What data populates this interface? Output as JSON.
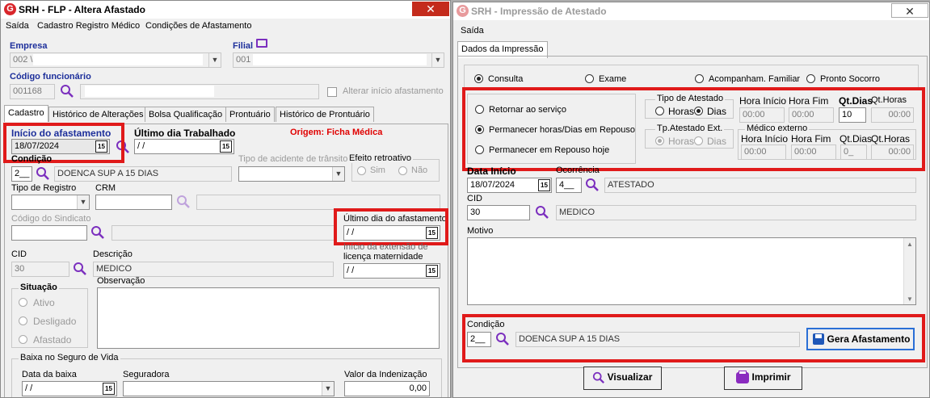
{
  "left": {
    "title": "SRH - FLP - Altera Afastado",
    "menu": [
      "Saída",
      "Cadastro Registro Médico",
      "Condições de Afastamento"
    ],
    "empresa_label": "Empresa",
    "empresa_value": "002 \\",
    "filial_label": "Filial",
    "filial_value": "001",
    "codigo_label": "Código funcionário",
    "codigo_value": "001168",
    "alterar_label": "Alterar início afastamento",
    "tabs": [
      "Cadastro",
      "Histórico de Alterações",
      "Bolsa Qualificação",
      "Prontuário",
      "Histórico de Prontuário"
    ],
    "inicio_label": "Início do afastamento",
    "inicio_value": "18/07/2024",
    "ultimo_trab_label": "Último dia Trabalhado",
    "ultimo_trab_value": "/ /",
    "origem_label": "Origem: Ficha Médica",
    "condicao_label": "Condição",
    "condicao_code": "2__",
    "condicao_desc": "DOENCA SUP A 15 DIAS",
    "tipo_acidente_label": "Tipo de acidente de trânsito",
    "efeito_label": "Efeito retroativo",
    "efeito_sim": "Sim",
    "efeito_nao": "Não",
    "tipo_registro_label": "Tipo de Registro",
    "crm_label": "CRM",
    "sindicato_label": "Código do Sindicato",
    "ultimo_afast_label": "Último dia do afastamento",
    "ultimo_afast_value": "/ /",
    "licenca_label_1": "Início da extensão de",
    "licenca_label_2": "licença maternidade",
    "licenca_value": "/ /",
    "cid_label": "CID",
    "cid_value": "30",
    "descricao_label": "Descrição",
    "descricao_value": "MEDICO",
    "situacao_label": "Situação",
    "situacao_ativo": "Ativo",
    "situacao_desligado": "Desligado",
    "situacao_afastado": "Afastado",
    "observacao_label": "Observação",
    "baixa_label": "Baixa no Seguro de Vida",
    "data_baixa_label": "Data da baixa",
    "data_baixa_value": "/ /",
    "seguradora_label": "Seguradora",
    "indenizacao_label": "Valor da Indenização",
    "indenizacao_value": "0,00"
  },
  "right": {
    "title": "SRH - Impressão de Atestado",
    "menu": [
      "Saída"
    ],
    "tab": "Dados da Impressão",
    "opt_consulta": "Consulta",
    "opt_exame": "Exame",
    "opt_acompanham": "Acompanham. Familiar",
    "opt_pronto": "Pronto Socorro",
    "opt_retornar": "Retornar ao serviço",
    "opt_permanecer": "Permanecer  horas/Dias em Repouso",
    "opt_permanecer_hoje": "Permanecer em Repouso hoje",
    "tipo_atestado_label": "Tipo de Atestado",
    "tipo_horas": "Horas",
    "tipo_dias": "Dias",
    "hora_inicio_label": "Hora Início",
    "hora_fim_label": "Hora Fim",
    "qt_dias_label": "Qt.Dias",
    "qt_horas_label": "Qt.Horas",
    "hora_inicio_value": "00:00",
    "hora_fim_value": "00:00",
    "qt_dias_value": "10",
    "qt_horas_value": "00:00",
    "tp_ext_label": "Tp.Atestado Ext.",
    "ext_horas": "Horas",
    "ext_dias": "Dias",
    "medico_externo_label": "Médico externo",
    "ext_hora_inicio_label": "Hora Início",
    "ext_hora_fim_label": "Hora Fim",
    "ext_qt_dias_label": "Qt.Dias",
    "ext_qt_horas_label": "Qt.Horas",
    "ext_hora_inicio_value": "00:00",
    "ext_hora_fim_value": "00:00",
    "ext_qt_dias_value": "0_",
    "ext_qt_horas_value": "00:00",
    "data_inicio_label": "Data Início",
    "data_inicio_value": "18/07/2024",
    "ocorrencia_label": "Ocorrência",
    "ocorrencia_code": "4__",
    "ocorrencia_desc": "ATESTADO",
    "cid_label": "CID",
    "cid_value": "30",
    "cid_desc": "MEDICO",
    "motivo_label": "Motivo",
    "condicao_label": "Condição",
    "condicao_code": "2__",
    "condicao_desc": "DOENCA SUP A 15 DIAS",
    "gera_btn": "Gera Afastamento",
    "visualizar_btn": "Visualizar",
    "imprimir_btn": "Imprimir"
  },
  "colors": {
    "accent_red": "#e01a1a",
    "label_blue": "#1d2f9b",
    "search_purple": "#7b2fbe"
  }
}
